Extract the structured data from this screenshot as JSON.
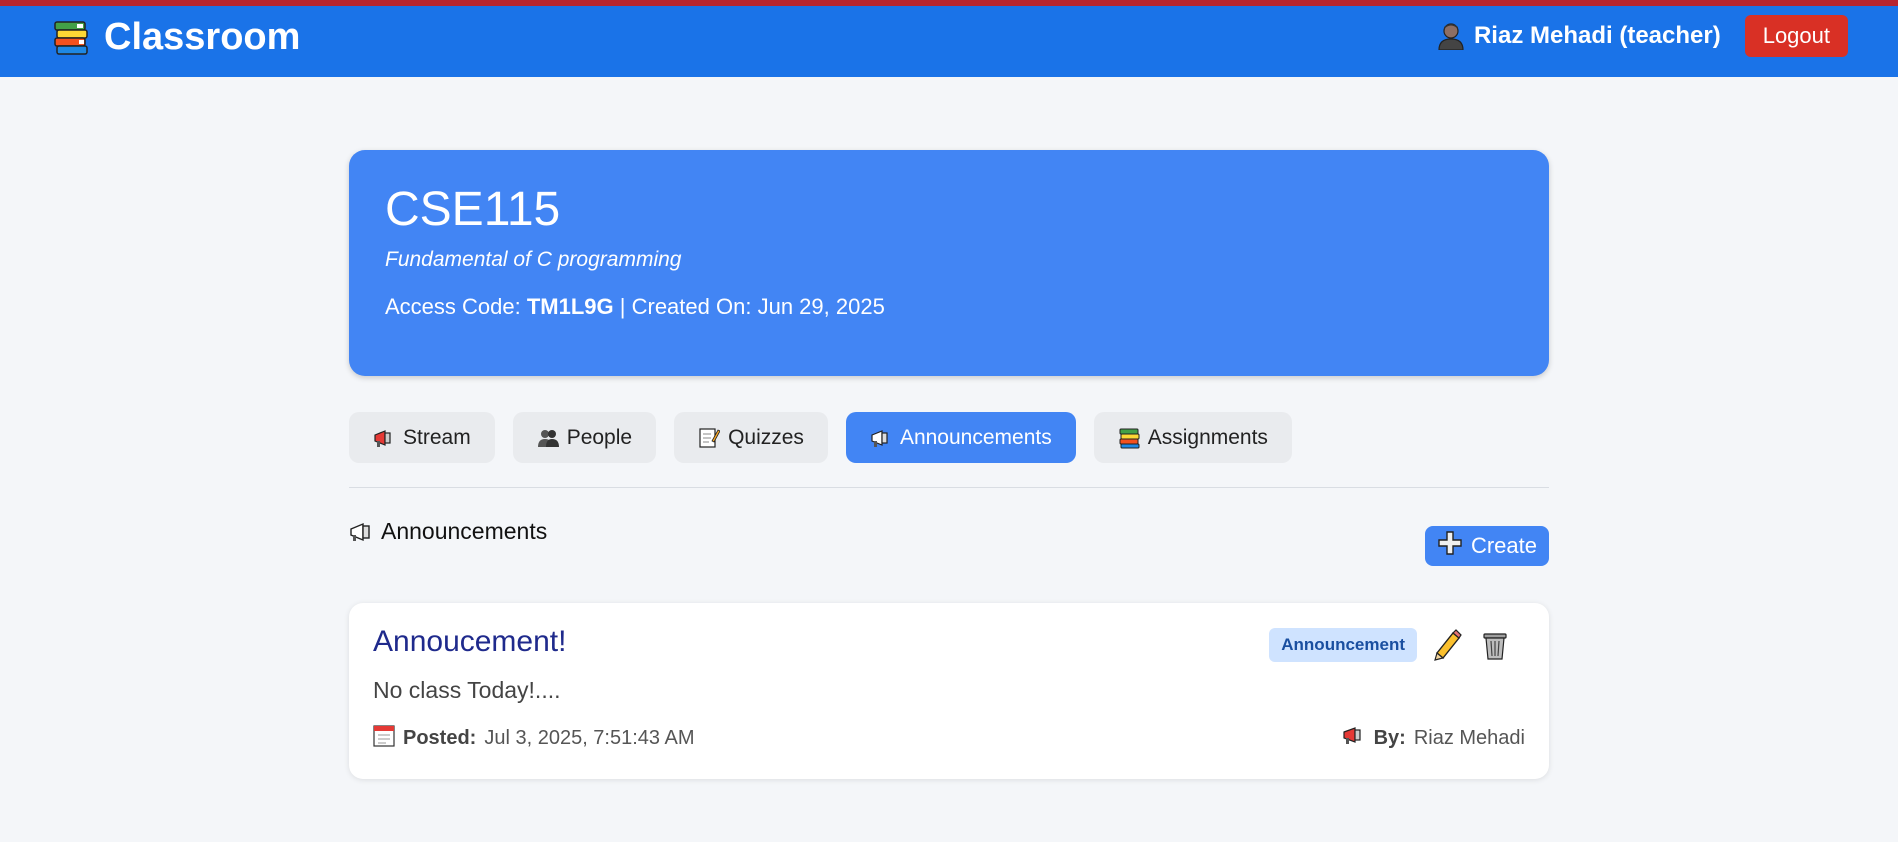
{
  "header": {
    "app_title": "Classroom",
    "user_label": "Riaz Mehadi (teacher)",
    "logout_label": "Logout"
  },
  "course": {
    "code": "CSE115",
    "name": "Fundamental of C programming",
    "access_code_label": "Access Code:",
    "access_code": "TM1L9G",
    "created_label": "| Created On:",
    "created_date": "Jun 29, 2025"
  },
  "tabs": [
    {
      "label": "Stream",
      "icon": "megaphone-icon",
      "active": false
    },
    {
      "label": "People",
      "icon": "people-icon",
      "active": false
    },
    {
      "label": "Quizzes",
      "icon": "memo-icon",
      "active": false
    },
    {
      "label": "Announcements",
      "icon": "megaphone-icon",
      "active": true
    },
    {
      "label": "Assignments",
      "icon": "books-icon",
      "active": false
    }
  ],
  "section": {
    "title": "Announcements",
    "create_label": "Create"
  },
  "announcement": {
    "title": "Annoucement!",
    "badge": "Announcement",
    "body": "No class Today!....",
    "posted_label": "Posted:",
    "posted_value": "Jul 3, 2025, 7:51:43 AM",
    "by_label": "By:",
    "by_value": "Riaz Mehadi"
  },
  "colors": {
    "header_bg": "#1a73e8",
    "accent": "#4285f4",
    "logout": "#d93025",
    "title_text": "#1f2a8c"
  }
}
